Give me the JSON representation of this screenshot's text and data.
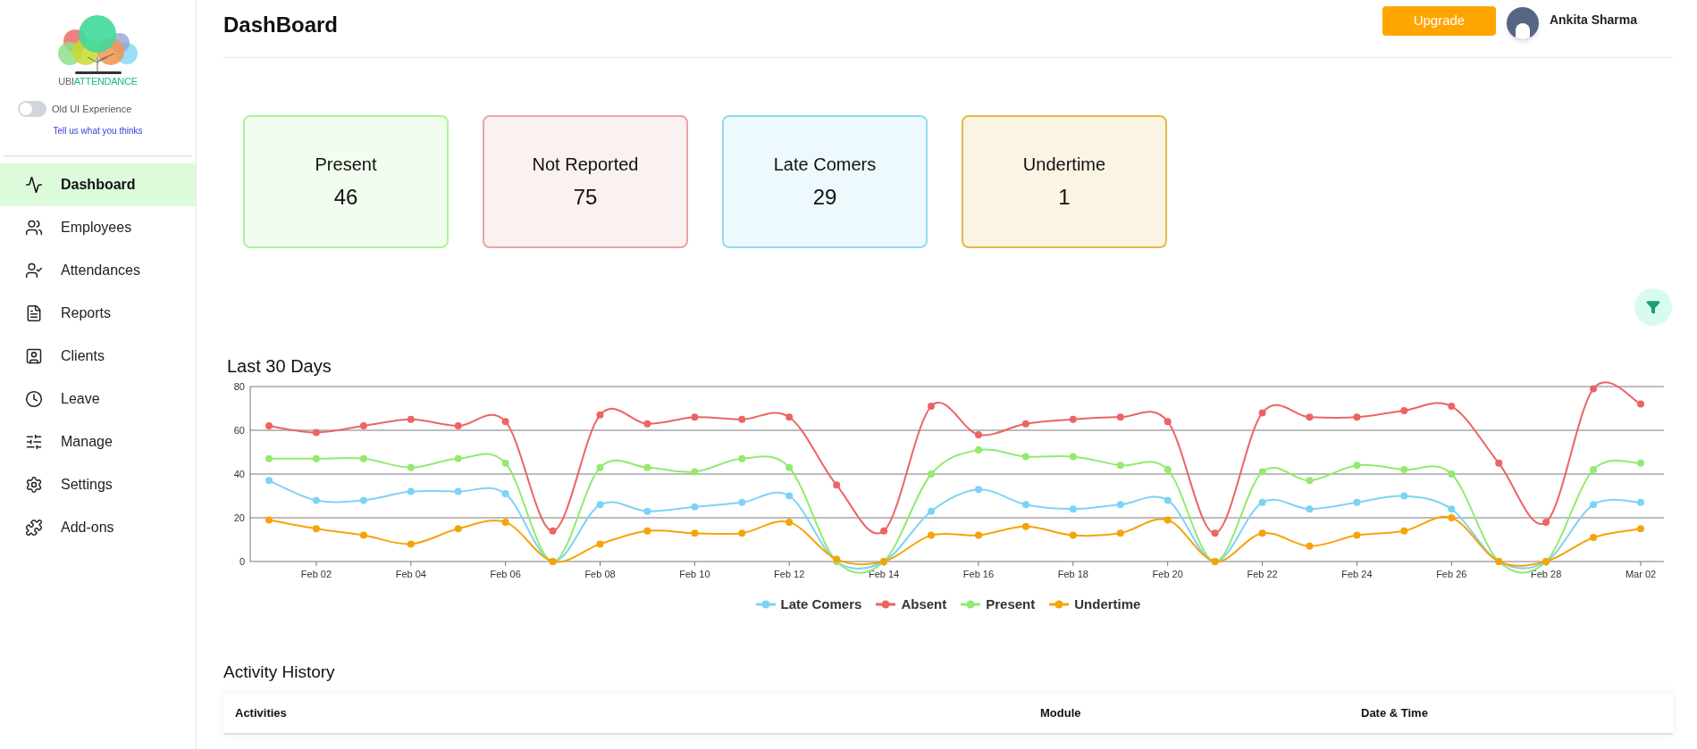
{
  "sidebar": {
    "logo": {
      "text_parts": [
        "UBI",
        "ATTENDANCE"
      ]
    },
    "old_ui_toggle": {
      "label": "Old UI Experience",
      "on": false
    },
    "feedback_link": "Tell us what you thinks",
    "items": [
      {
        "label": "Dashboard",
        "selected": true
      },
      {
        "label": "Employees",
        "selected": false
      },
      {
        "label": "Attendances",
        "selected": false
      },
      {
        "label": "Reports",
        "selected": false
      },
      {
        "label": "Clients",
        "selected": false
      },
      {
        "label": "Leave",
        "selected": false
      },
      {
        "label": "Manage",
        "selected": false
      },
      {
        "label": "Settings",
        "selected": false
      },
      {
        "label": "Add-ons",
        "selected": false
      }
    ]
  },
  "header": {
    "title": "DashBoard",
    "upgrade_button": "Upgrade",
    "user_name": "Ankita Sharma"
  },
  "stat_cards": [
    {
      "label": "Present",
      "value": "46",
      "color": "#a9f59a"
    },
    {
      "label": "Not Reported",
      "value": "75",
      "color": "#e9a6a6"
    },
    {
      "label": "Late Comers",
      "value": "29",
      "color": "#94daf0"
    },
    {
      "label": "Undertime",
      "value": "1",
      "color": "#e5b84a"
    }
  ],
  "chart_section": {
    "title": "Last 30 Days",
    "chart_data": {
      "type": "line",
      "categories": [
        null,
        "Feb 02",
        null,
        "Feb 04",
        null,
        "Feb 06",
        null,
        "Feb 08",
        null,
        "Feb 10",
        null,
        "Feb 12",
        null,
        "Feb 14",
        null,
        "Feb 16",
        null,
        "Feb 18",
        null,
        "Feb 20",
        null,
        "Feb 22",
        null,
        "Feb 24",
        null,
        "Feb 26",
        null,
        "Feb 28",
        null,
        "Mar 02"
      ],
      "ylim": [
        0,
        80
      ],
      "yticks": [
        0,
        20,
        40,
        60,
        80
      ],
      "grid": "y",
      "legend": "bottom",
      "series": [
        {
          "name": "Late Comers",
          "color": "#7dd3f5",
          "marker": "circle",
          "values": [
            37,
            28,
            28,
            32,
            32,
            31,
            0,
            26,
            23,
            25,
            27,
            30,
            0,
            0,
            23,
            33,
            26,
            24,
            26,
            28,
            0,
            27,
            24,
            27,
            30,
            24,
            0,
            0,
            26,
            27
          ]
        },
        {
          "name": "Absent",
          "color": "#ec6464",
          "marker": "circle",
          "values": [
            62,
            59,
            62,
            65,
            62,
            64,
            14,
            67,
            63,
            66,
            65,
            66,
            35,
            14,
            71,
            58,
            63,
            65,
            66,
            64,
            13,
            68,
            66,
            66,
            69,
            71,
            45,
            18,
            79,
            72
          ]
        },
        {
          "name": "Present",
          "color": "#92ea6e",
          "marker": "circle",
          "values": [
            47,
            47,
            47,
            43,
            47,
            45,
            0,
            43,
            43,
            41,
            47,
            43,
            0,
            0,
            40,
            51,
            48,
            48,
            44,
            42,
            0,
            41,
            37,
            44,
            42,
            40,
            0,
            0,
            42,
            45
          ]
        },
        {
          "name": "Undertime",
          "color": "#f5a30a",
          "marker": "circle",
          "values": [
            19,
            15,
            12,
            8,
            15,
            18,
            0,
            8,
            14,
            13,
            13,
            18,
            1,
            0,
            12,
            12,
            16,
            12,
            13,
            19,
            0,
            13,
            7,
            12,
            14,
            20,
            0,
            0,
            11,
            15
          ]
        }
      ]
    }
  },
  "activity_history": {
    "title": "Activity History",
    "columns": [
      "Activities",
      "Module",
      "Date & Time"
    ]
  }
}
